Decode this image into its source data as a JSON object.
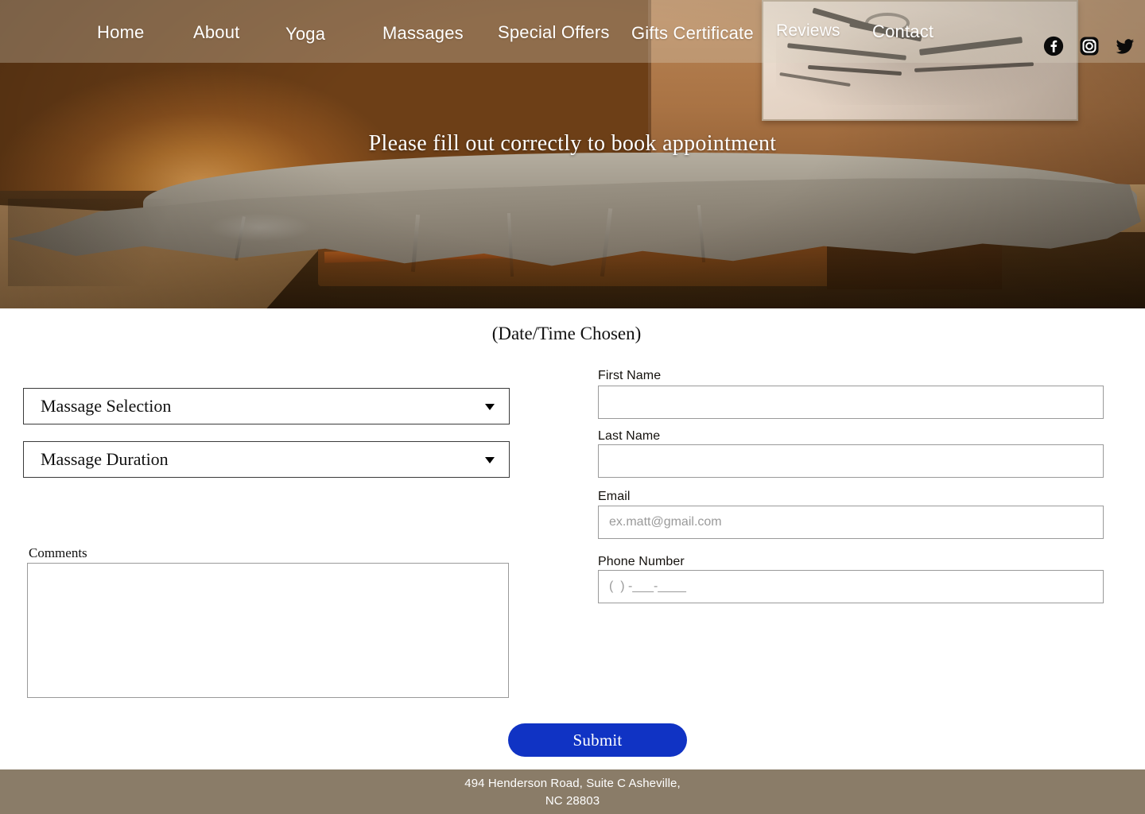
{
  "nav": {
    "items": [
      {
        "label": "Home",
        "name": "nav-item-home"
      },
      {
        "label": "About",
        "name": "nav-item-about"
      },
      {
        "label": "Yoga",
        "name": "nav-item-yoga"
      },
      {
        "label": "Massages",
        "name": "nav-item-massages"
      },
      {
        "label": "Special Offers",
        "name": "nav-item-special-offers"
      },
      {
        "label": "Gifts Certificate",
        "name": "nav-item-gifts-certificate"
      },
      {
        "label": "Reviews",
        "name": "nav-item-reviews"
      },
      {
        "label": "Contact",
        "name": "nav-item-contact"
      }
    ],
    "socials": [
      {
        "icon": "facebook-icon",
        "label": "Facebook"
      },
      {
        "icon": "instagram-icon",
        "label": "Instagram"
      },
      {
        "icon": "twitter-icon",
        "label": "Twitter"
      }
    ]
  },
  "hero": {
    "title": "Please fill out correctly to book appointment"
  },
  "form": {
    "date_time_heading": "(Date/Time Chosen)",
    "selects": [
      {
        "label": "Massage Selection",
        "name": "massage-selection-select"
      },
      {
        "label": "Massage Duration",
        "name": "massage-duration-select"
      }
    ],
    "comments": {
      "label": "Comments",
      "value": "",
      "placeholder": ""
    },
    "fields": [
      {
        "label": "First Name",
        "value": "",
        "placeholder": ""
      },
      {
        "label": "Last Name",
        "value": "",
        "placeholder": ""
      },
      {
        "label": "Email",
        "value": "",
        "placeholder": "ex.matt@gmail.com"
      },
      {
        "label": "Phone Number",
        "value": "",
        "placeholder": "(  ) -___-____"
      }
    ],
    "submit_label": "Submit"
  },
  "footer": {
    "address_line1": "494 Henderson Road, Suite C Asheville,",
    "address_line2": "NC 28803"
  },
  "colors": {
    "submit_button": "#1033c4",
    "footer_background": "#8a7c68",
    "nav_text": "#ffffff"
  }
}
